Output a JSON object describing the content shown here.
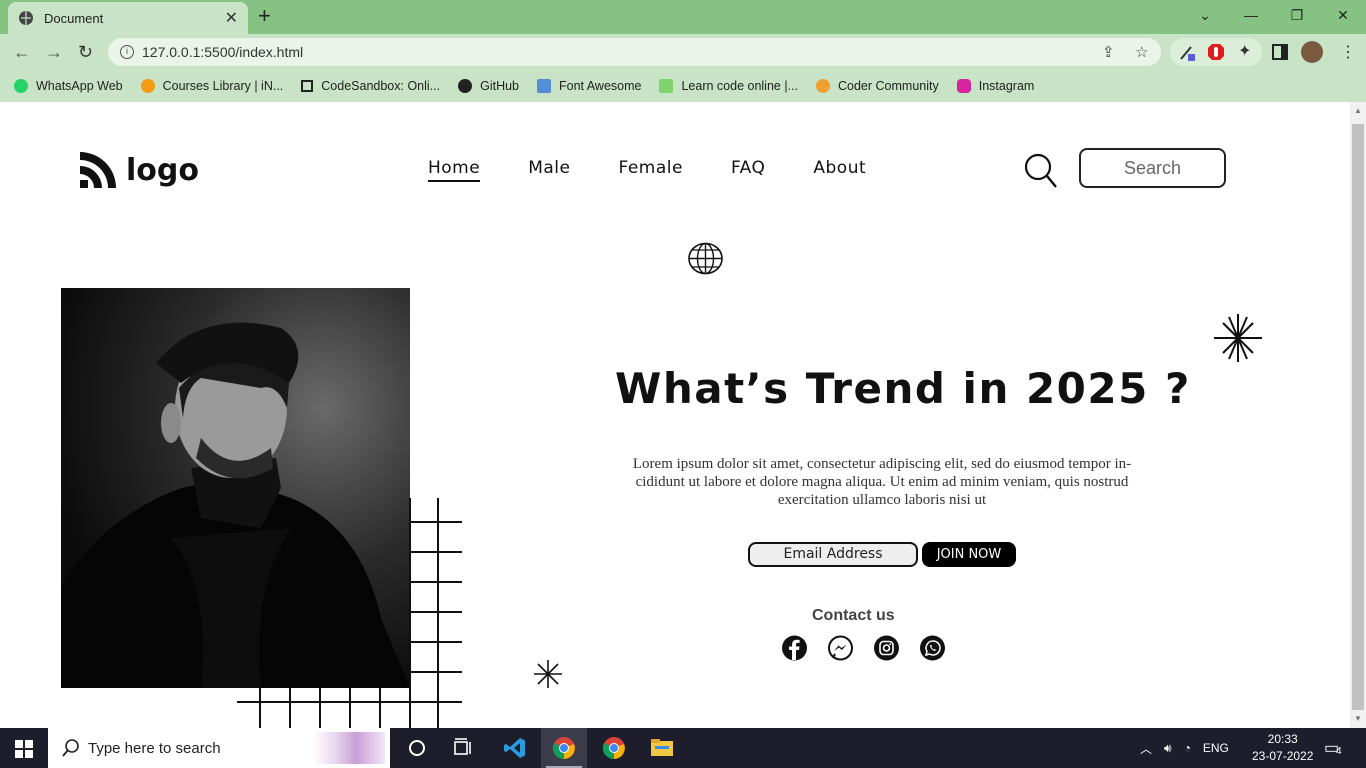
{
  "browser": {
    "tab_title": "Document",
    "url": "127.0.0.1:5500/index.html",
    "bookmarks": [
      {
        "label": "WhatsApp Web",
        "color": "#25d366"
      },
      {
        "label": "Courses Library | iN...",
        "color": "#f39c12"
      },
      {
        "label": "CodeSandbox: Onli...",
        "color": "#222222"
      },
      {
        "label": "GitHub",
        "color": "#222222"
      },
      {
        "label": "Font Awesome",
        "color": "#538dd7"
      },
      {
        "label": "Learn code online |...",
        "color": "#7fd36b"
      },
      {
        "label": "Coder Community",
        "color": "#f0a030"
      },
      {
        "label": "Instagram",
        "color": "#d6249f"
      }
    ]
  },
  "site": {
    "logo_text": "logo",
    "nav": [
      "Home",
      "Male",
      "Female",
      "FAQ",
      "About"
    ],
    "search_placeholder": "Search",
    "headline": "What’s Trend in 2025 ?",
    "paragraph": "Lorem ipsum dolor sit amet, consectetur adipiscing elit, sed do eiusmod tempor in-cididunt ut labore et dolore magna aliqua. Ut enim ad minim veniam, quis nostrud exercitation ullamco laboris nisi ut",
    "email_placeholder": "Email Address",
    "join_label": "JOIN NOW",
    "contact_label": "Contact us",
    "social": [
      "facebook-icon",
      "messenger-icon",
      "instagram-icon",
      "whatsapp-icon"
    ]
  },
  "taskbar": {
    "search_placeholder": "Type here to search",
    "lang": "ENG",
    "time": "20:33",
    "date": "23-07-2022",
    "notifications": "4"
  }
}
